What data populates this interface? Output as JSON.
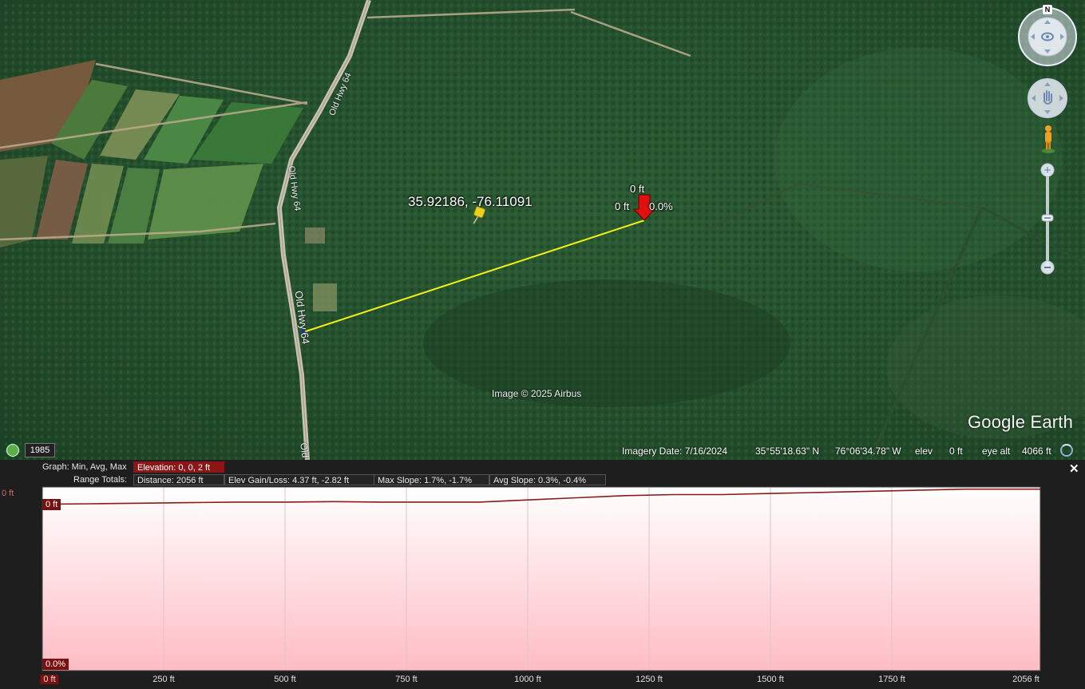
{
  "map": {
    "road_labels": [
      "Old Hwy 64",
      "Old Hwy 64",
      "Old Hwy 64",
      "Old"
    ],
    "placemark_label": "35.92186, -76.11091",
    "path_labels": {
      "top": "0 ft",
      "left": "0 ft",
      "right": "0.0%"
    },
    "copyright": "Image © 2025 Airbus",
    "logo": "Google Earth",
    "compass_north": "N",
    "history_year": "1985",
    "status": {
      "imagery_date": "Imagery Date: 7/16/2024",
      "lat": "35°55'18.63\" N",
      "lon": "76°06'34.78\" W",
      "elev_label": "elev",
      "elev_value": "0 ft",
      "eye_alt_label": "eye alt",
      "eye_alt_value": "4066 ft"
    },
    "colors": {
      "path": "#f4f01a",
      "pin": "#e01010",
      "placemark": "#e8d11c"
    }
  },
  "profile": {
    "graph_label": "Graph: Min, Avg, Max",
    "elevation": "Elevation: 0, 0, 2 ft",
    "range_totals_label": "Range Totals:",
    "distance": "Distance: 2056 ft",
    "elev_gain_loss": "Elev Gain/Loss: 4.37 ft, -2.82 ft",
    "max_slope": "Max Slope: 1.7%, -1.7%",
    "avg_slope": "Avg Slope: 0.3%, -0.4%",
    "y_top_label": "0 ft",
    "y_marker_top": "0 ft",
    "y_marker_bottom": "0.0%",
    "close_icon": "close-icon",
    "colors": {
      "fill_top": "#ffffff",
      "fill_bottom": "#ffbcc4",
      "line": "#8b1a1a",
      "tag": "#7a1010"
    }
  },
  "chart_data": {
    "type": "area",
    "x_ticks": [
      "0 ft",
      "250 ft",
      "500 ft",
      "750 ft",
      "1000 ft",
      "1250 ft",
      "1500 ft",
      "1750 ft",
      "2056 ft"
    ],
    "x": [
      0,
      100,
      200,
      300,
      400,
      500,
      600,
      700,
      800,
      900,
      1000,
      1100,
      1200,
      1300,
      1400,
      1500,
      1600,
      1700,
      1800,
      1900,
      2000,
      2056
    ],
    "y": [
      0.4,
      0.45,
      0.5,
      0.55,
      0.6,
      0.6,
      0.65,
      0.6,
      0.6,
      0.6,
      0.8,
      1.0,
      1.2,
      1.3,
      1.3,
      1.4,
      1.5,
      1.6,
      1.7,
      1.8,
      1.8,
      1.8
    ],
    "xlim": [
      0,
      2056
    ],
    "ylim": [
      -15,
      2
    ],
    "grid": true
  }
}
